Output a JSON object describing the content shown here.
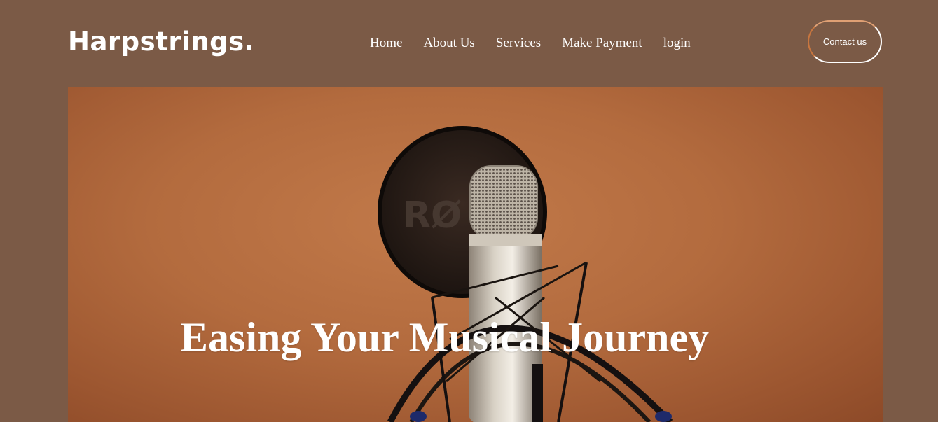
{
  "header": {
    "logo": "Harpstrings.",
    "nav": [
      {
        "label": "Home"
      },
      {
        "label": "About Us"
      },
      {
        "label": "Services"
      },
      {
        "label": "Make Payment"
      },
      {
        "label": "login"
      }
    ],
    "contact_label": "Contact us"
  },
  "hero": {
    "title": "Easing Your Musical Journey",
    "image_subject": "studio condenser microphone with pop filter",
    "pop_filter_text": "RØ"
  },
  "colors": {
    "page_background": "#7b5a46",
    "hero_background": "#b36b3e",
    "text": "#ffffff",
    "button_accent": "#c9763f"
  }
}
